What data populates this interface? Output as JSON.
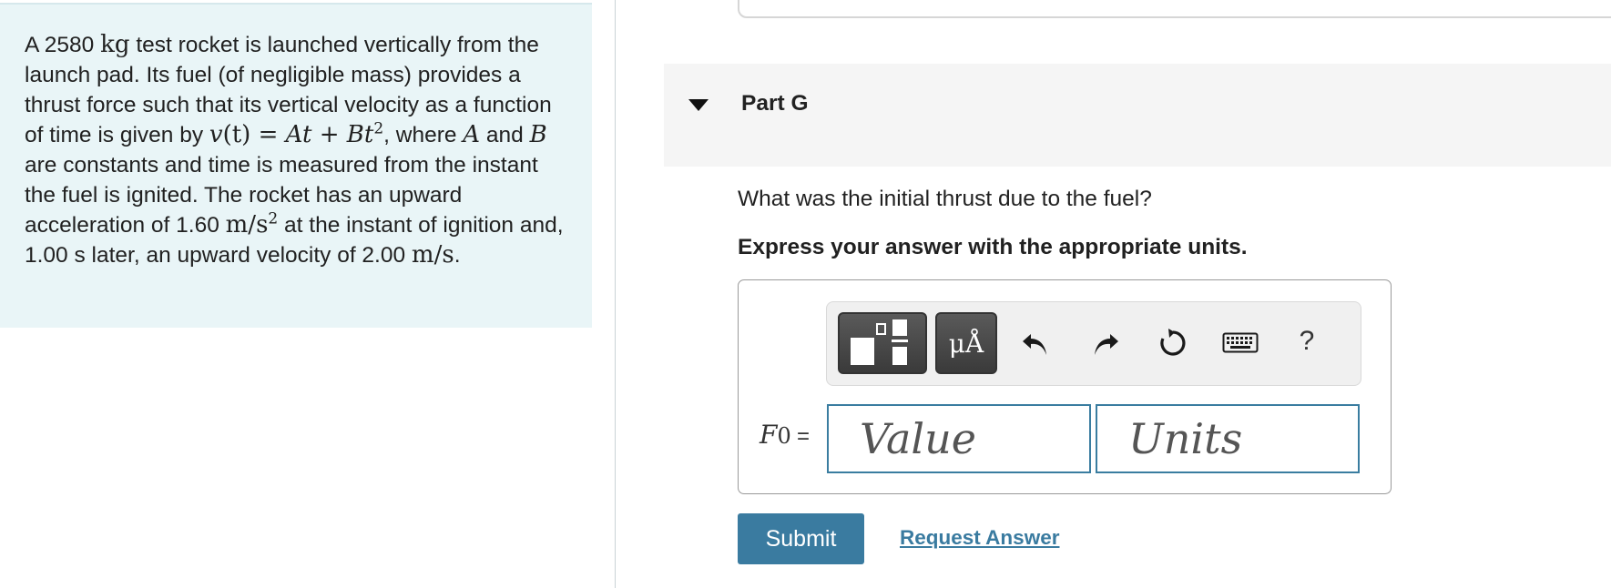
{
  "problem": {
    "t1": "A 2580 ",
    "m_kg": "kg",
    "t2": " test rocket is launched vertically from the launch pad. Its fuel (of negligible mass) provides a thrust force such that its vertical velocity as a function of time is given by ",
    "m_v": "v",
    "m_eq": "(t) = ",
    "m_A": "A",
    "m_t1": "t + ",
    "m_B": "B",
    "m_t2": "t",
    "m_exp": "2",
    "t3": ", where ",
    "m_A2": "A",
    "t4": " and ",
    "m_B2": "B",
    "t5": " are constants and time is measured from the instant the fuel is ignited. The rocket has an upward acceleration of 1.60 ",
    "m_acc": "m/s",
    "m_acc_exp": "2",
    "t6": " at the instant of ignition and, 1.00 s later, an upward velocity of 2.00 ",
    "m_vel": "m/s",
    "t7": "."
  },
  "part": {
    "title": "Part G"
  },
  "question": "What was the initial thrust due to the fuel?",
  "instruction": "Express your answer with the appropriate units.",
  "toolbar": {
    "units_button_label": "μÅ",
    "help_label": "?",
    "icons": [
      "templates-icon",
      "units-icon",
      "undo-icon",
      "redo-icon",
      "reset-icon",
      "keyboard-icon",
      "help-icon"
    ]
  },
  "answer": {
    "variable": "F",
    "variable_sub": "0",
    "equals": "=",
    "value_placeholder": "Value",
    "units_placeholder": "Units"
  },
  "actions": {
    "submit_label": "Submit",
    "request_label": "Request Answer"
  },
  "colors": {
    "panel_bg": "#e9f5f7",
    "accent": "#3a7ba0",
    "header_bg": "#f5f5f5"
  }
}
